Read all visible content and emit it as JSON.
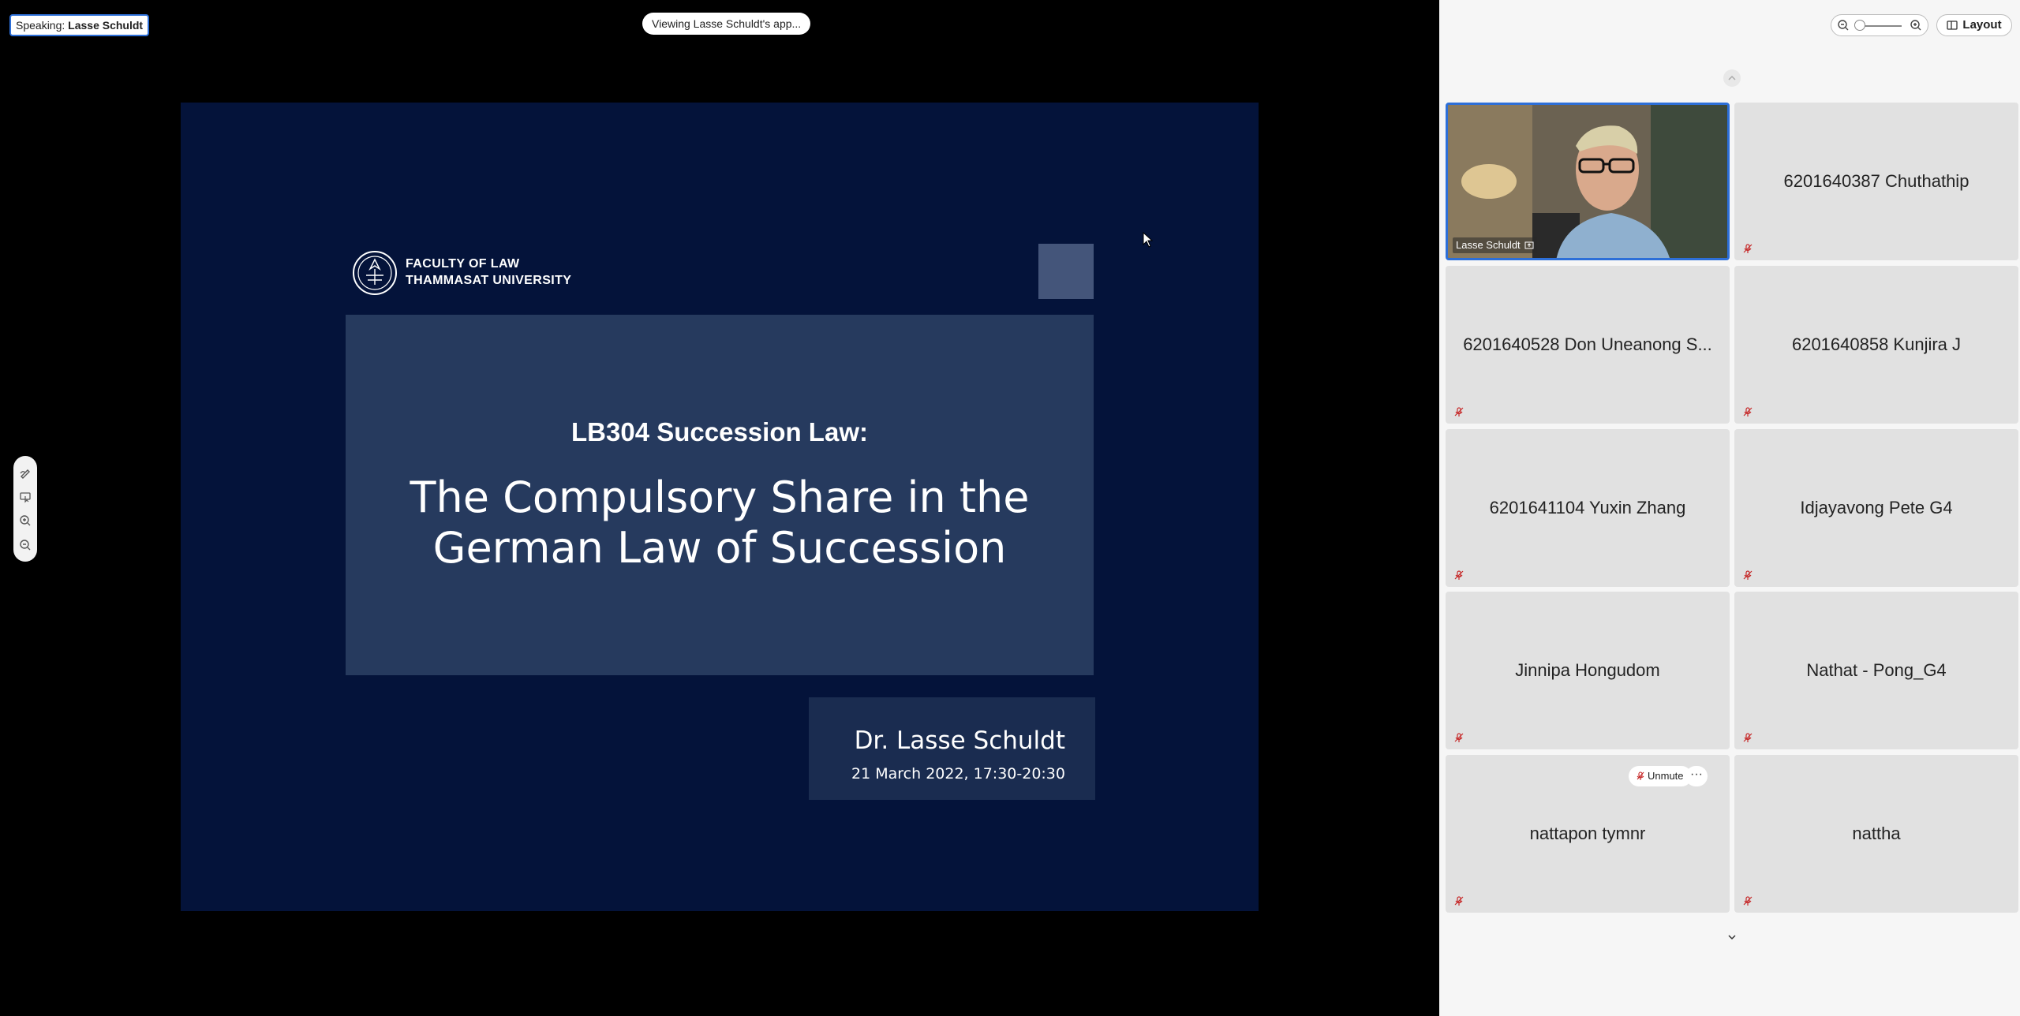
{
  "share": {
    "speaking_prefix": "Speaking:",
    "speaking_name": "Lasse Schuldt",
    "viewing_label": "Viewing Lasse Schuldt's app..."
  },
  "slide": {
    "faculty_line1": "FACULTY OF LAW",
    "faculty_line2": "THAMMASAT UNIVERSITY",
    "course": "LB304 Succession Law:",
    "title_line1": "The Compulsory Share in the",
    "title_line2": "German Law of Succession",
    "author": "Dr. Lasse Schuldt",
    "date": "21 March 2022, 17:30-20:30"
  },
  "annotation_tools": [
    "annotate-pen-icon",
    "remote-control-icon",
    "zoom-in-icon",
    "zoom-out-icon"
  ],
  "panel": {
    "layout_label": "Layout",
    "unmute_label": "Unmute",
    "more_label": "···",
    "participants": [
      {
        "name": "Lasse Schuldt",
        "video": true
      },
      {
        "name": "6201640387 Chuthathip",
        "muted": true
      },
      {
        "name": "6201640528 Don Uneanong S...",
        "muted": true
      },
      {
        "name": "6201640858 Kunjira J",
        "muted": true
      },
      {
        "name": "6201641104 Yuxin Zhang",
        "muted": true
      },
      {
        "name": "Idjayavong Pete G4",
        "muted": true
      },
      {
        "name": "Jinnipa Hongudom",
        "muted": true
      },
      {
        "name": "Nathat - Pong_G4",
        "muted": true
      },
      {
        "name": "nattapon tymnr",
        "muted": true
      },
      {
        "name": "nattha",
        "muted": true
      }
    ]
  },
  "colors": {
    "slide_bg": "#04133a",
    "title_box": "#263a5e",
    "author_box": "#1a2c50",
    "active_speaker_border": "#2d6fd8",
    "muted_mic": "#c62828"
  }
}
